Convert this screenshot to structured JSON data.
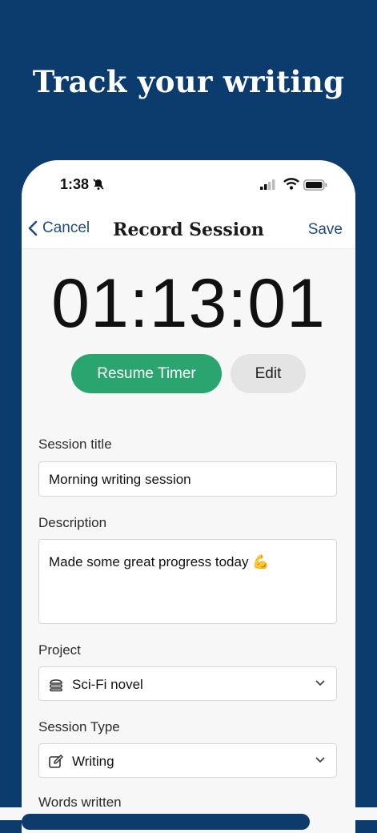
{
  "promo": {
    "headline": "Track your writing"
  },
  "status": {
    "time": "1:38"
  },
  "nav": {
    "cancel": "Cancel",
    "title": "Record Session",
    "save": "Save"
  },
  "timer": {
    "value": "01:13:01",
    "resume": "Resume Timer",
    "edit": "Edit"
  },
  "form": {
    "title_label": "Session title",
    "title_value": "Morning writing session",
    "description_label": "Description",
    "description_value": "Made some great progress today 💪",
    "project_label": "Project",
    "project_value": "Sci-Fi novel",
    "session_type_label": "Session Type",
    "session_type_value": "Writing",
    "words_label": "Words written"
  },
  "colors": {
    "background": "#0c3b6e",
    "accent": "#2aa570",
    "link": "#1f4b80"
  }
}
